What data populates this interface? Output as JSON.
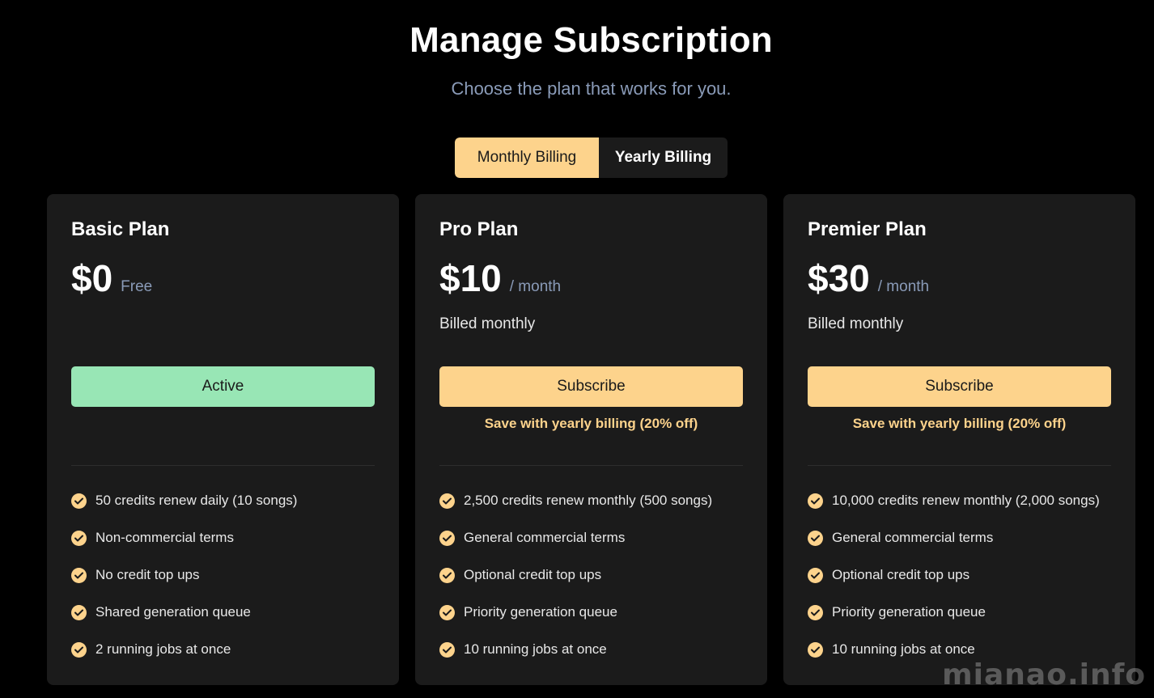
{
  "header": {
    "title": "Manage Subscription",
    "subtitle": "Choose the plan that works for you."
  },
  "billing_toggle": {
    "options": [
      {
        "label": "Monthly Billing",
        "selected": true
      },
      {
        "label": "Yearly Billing",
        "selected": false
      }
    ]
  },
  "plans": [
    {
      "name": "Basic Plan",
      "price": "$0",
      "price_suffix": "Free",
      "billed_note": "",
      "button_label": "Active",
      "save_note": "",
      "features": [
        "50 credits renew daily (10 songs)",
        "Non-commercial terms",
        "No credit top ups",
        "Shared generation queue",
        "2 running jobs at once"
      ]
    },
    {
      "name": "Pro Plan",
      "price": "$10",
      "price_suffix": "/ month",
      "billed_note": "Billed monthly",
      "button_label": "Subscribe",
      "save_note": "Save with yearly billing (20% off)",
      "features": [
        "2,500 credits renew monthly (500 songs)",
        "General commercial terms",
        "Optional credit top ups",
        "Priority generation queue",
        "10 running jobs at once"
      ]
    },
    {
      "name": "Premier Plan",
      "price": "$30",
      "price_suffix": "/ month",
      "billed_note": "Billed monthly",
      "button_label": "Subscribe",
      "save_note": "Save with yearly billing (20% off)",
      "features": [
        "10,000 credits renew monthly (2,000 songs)",
        "General commercial terms",
        "Optional credit top ups",
        "Priority generation queue",
        "10 running jobs at once"
      ]
    }
  ],
  "watermark": "mianao.info",
  "colors": {
    "accent": "#fdd38c",
    "active_green": "#98e6b5",
    "card_bg": "#1b1b1b",
    "muted_text": "#8a9bb8"
  }
}
